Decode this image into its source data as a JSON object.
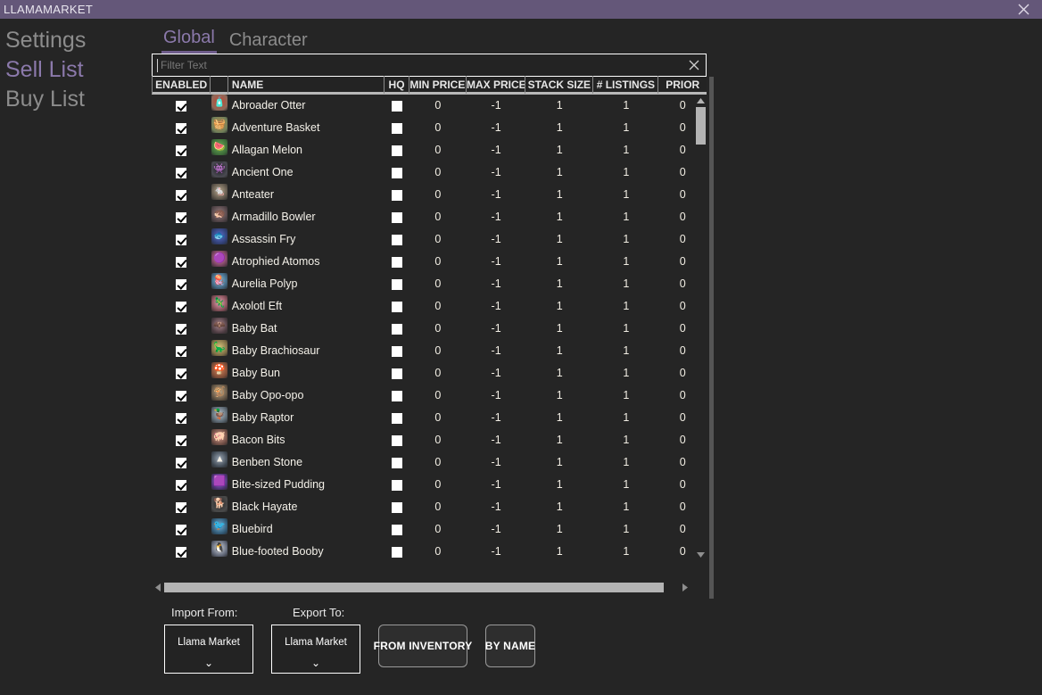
{
  "window": {
    "title": "LLAMAMARKET",
    "titlebar_color": "#645779",
    "close_icon": "close-icon"
  },
  "sidebar": {
    "items": [
      {
        "label": "Settings",
        "active": false
      },
      {
        "label": "Sell List",
        "active": true
      },
      {
        "label": "Buy List",
        "active": false
      }
    ],
    "active_color": "#8b79ab",
    "inactive_color": "#8c8c8c"
  },
  "tabs": [
    {
      "label": "Global",
      "active": true
    },
    {
      "label": "Character",
      "active": false
    }
  ],
  "filter": {
    "value": "",
    "placeholder": "Filter Text",
    "clear_icon": "close-icon"
  },
  "table": {
    "columns": [
      {
        "key": "enabled",
        "label": "ENABLED"
      },
      {
        "key": "icon",
        "label": ""
      },
      {
        "key": "name",
        "label": "NAME"
      },
      {
        "key": "hq",
        "label": "HQ"
      },
      {
        "key": "min",
        "label": "MIN PRICE"
      },
      {
        "key": "max",
        "label": "MAX PRICE"
      },
      {
        "key": "stack",
        "label": "STACK SIZE"
      },
      {
        "key": "listings",
        "label": "# LISTINGS"
      },
      {
        "key": "prior",
        "label": "PRIOR"
      }
    ],
    "rows": [
      {
        "enabled": true,
        "name": "Abroader Otter",
        "hq": false,
        "min": "0",
        "max": "-1",
        "stack": "1",
        "listings": "1",
        "prior": "0",
        "icon_color1": "#8d6a5a",
        "icon_color2": "#c9422f",
        "glyph": "🧴"
      },
      {
        "enabled": true,
        "name": "Adventure Basket",
        "hq": false,
        "min": "0",
        "max": "-1",
        "stack": "1",
        "listings": "1",
        "prior": "0",
        "icon_color1": "#6f7f5a",
        "icon_color2": "#c08a4a",
        "glyph": "🧺"
      },
      {
        "enabled": true,
        "name": "Allagan Melon",
        "hq": false,
        "min": "0",
        "max": "-1",
        "stack": "1",
        "listings": "1",
        "prior": "0",
        "icon_color1": "#3c6b38",
        "icon_color2": "#6fb05a",
        "glyph": "🍉"
      },
      {
        "enabled": true,
        "name": "Ancient One",
        "hq": false,
        "min": "0",
        "max": "-1",
        "stack": "1",
        "listings": "1",
        "prior": "0",
        "icon_color1": "#4a4a52",
        "icon_color2": "#1d1d22",
        "glyph": "👾"
      },
      {
        "enabled": true,
        "name": "Anteater",
        "hq": false,
        "min": "0",
        "max": "-1",
        "stack": "1",
        "listings": "1",
        "prior": "0",
        "icon_color1": "#5a5248",
        "icon_color2": "#b9a98e",
        "glyph": "🐁"
      },
      {
        "enabled": true,
        "name": "Armadillo Bowler",
        "hq": false,
        "min": "0",
        "max": "-1",
        "stack": "1",
        "listings": "1",
        "prior": "0",
        "icon_color1": "#4f4246",
        "icon_color2": "#9b7f80",
        "glyph": "🦔"
      },
      {
        "enabled": true,
        "name": "Assassin Fry",
        "hq": false,
        "min": "0",
        "max": "-1",
        "stack": "1",
        "listings": "1",
        "prior": "0",
        "icon_color1": "#2f3d6e",
        "icon_color2": "#5a6fd0",
        "glyph": "🐟"
      },
      {
        "enabled": true,
        "name": "Atrophied Atomos",
        "hq": false,
        "min": "0",
        "max": "-1",
        "stack": "1",
        "listings": "1",
        "prior": "0",
        "icon_color1": "#6e3f58",
        "icon_color2": "#e887b5",
        "glyph": "🟣"
      },
      {
        "enabled": true,
        "name": "Aurelia Polyp",
        "hq": false,
        "min": "0",
        "max": "-1",
        "stack": "1",
        "listings": "1",
        "prior": "0",
        "icon_color1": "#3e5f78",
        "icon_color2": "#7fc4e8",
        "glyph": "🪼"
      },
      {
        "enabled": true,
        "name": "Axolotl Eft",
        "hq": false,
        "min": "0",
        "max": "-1",
        "stack": "1",
        "listings": "1",
        "prior": "0",
        "icon_color1": "#7a4a52",
        "icon_color2": "#f0a0b4",
        "glyph": "🦎"
      },
      {
        "enabled": true,
        "name": "Baby Bat",
        "hq": false,
        "min": "0",
        "max": "-1",
        "stack": "1",
        "listings": "1",
        "prior": "0",
        "icon_color1": "#4a3a40",
        "icon_color2": "#b08a92",
        "glyph": "🦇"
      },
      {
        "enabled": true,
        "name": "Baby Brachiosaur",
        "hq": false,
        "min": "0",
        "max": "-1",
        "stack": "1",
        "listings": "1",
        "prior": "0",
        "icon_color1": "#7a6a44",
        "icon_color2": "#d8c47a",
        "glyph": "🦕"
      },
      {
        "enabled": true,
        "name": "Baby Bun",
        "hq": false,
        "min": "0",
        "max": "-1",
        "stack": "1",
        "listings": "1",
        "prior": "0",
        "icon_color1": "#7a4a36",
        "icon_color2": "#d9855a",
        "glyph": "🍄"
      },
      {
        "enabled": true,
        "name": "Baby Opo-opo",
        "hq": false,
        "min": "0",
        "max": "-1",
        "stack": "1",
        "listings": "1",
        "prior": "0",
        "icon_color1": "#5e5040",
        "icon_color2": "#c2ad8e",
        "glyph": "🐒"
      },
      {
        "enabled": true,
        "name": "Baby Raptor",
        "hq": false,
        "min": "0",
        "max": "-1",
        "stack": "1",
        "listings": "1",
        "prior": "0",
        "icon_color1": "#55606a",
        "icon_color2": "#b9c7d2",
        "glyph": "🦆"
      },
      {
        "enabled": true,
        "name": "Bacon Bits",
        "hq": false,
        "min": "0",
        "max": "-1",
        "stack": "1",
        "listings": "1",
        "prior": "0",
        "icon_color1": "#6b4a42",
        "icon_color2": "#d9a090",
        "glyph": "🐖"
      },
      {
        "enabled": true,
        "name": "Benben Stone",
        "hq": false,
        "min": "0",
        "max": "-1",
        "stack": "1",
        "listings": "1",
        "prior": "0",
        "icon_color1": "#3d4650",
        "icon_color2": "#9aa6b4",
        "glyph": "▲"
      },
      {
        "enabled": true,
        "name": "Bite-sized Pudding",
        "hq": false,
        "min": "0",
        "max": "-1",
        "stack": "1",
        "listings": "1",
        "prior": "0",
        "icon_color1": "#4a3070",
        "icon_color2": "#a377e0",
        "glyph": "🟪"
      },
      {
        "enabled": true,
        "name": "Black Hayate",
        "hq": false,
        "min": "0",
        "max": "-1",
        "stack": "1",
        "listings": "1",
        "prior": "0",
        "icon_color1": "#4a4a4a",
        "icon_color2": "#2a2a2a",
        "glyph": "🐕"
      },
      {
        "enabled": true,
        "name": "Bluebird",
        "hq": false,
        "min": "0",
        "max": "-1",
        "stack": "1",
        "listings": "1",
        "prior": "0",
        "icon_color1": "#2f5570",
        "icon_color2": "#73b6dd",
        "glyph": "🐦"
      },
      {
        "enabled": true,
        "name": "Blue-footed Booby",
        "hq": false,
        "min": "0",
        "max": "-1",
        "stack": "1",
        "listings": "1",
        "prior": "0",
        "icon_color1": "#5a6070",
        "icon_color2": "#cfd6e0",
        "glyph": "🐧"
      }
    ]
  },
  "bottom": {
    "import_label": "Import From:",
    "export_label": "Export To:",
    "import_value": "Llama Market",
    "export_value": "Llama Market",
    "caret": "⌄",
    "from_inventory_label": "FROM INVENTORY",
    "by_name_label": "BY NAME"
  }
}
